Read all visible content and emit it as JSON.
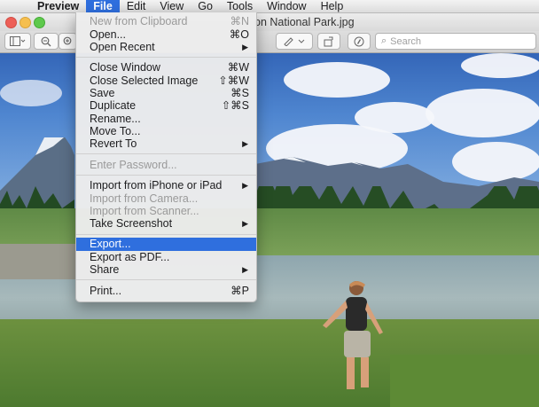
{
  "menubar": {
    "app": "Preview",
    "items": [
      "File",
      "Edit",
      "View",
      "Go",
      "Tools",
      "Window",
      "Help"
    ]
  },
  "window": {
    "title": "on National Park.jpg",
    "search_placeholder": "Search"
  },
  "file_menu": {
    "items": [
      {
        "label": "New from Clipboard",
        "shortcut": "⌘N",
        "disabled": true
      },
      {
        "label": "Open...",
        "shortcut": "⌘O"
      },
      {
        "label": "Open Recent",
        "submenu": true
      },
      {
        "label": "Close Window",
        "shortcut": "⌘W"
      },
      {
        "label": "Close Selected Image",
        "shortcut": "⇧⌘W"
      },
      {
        "label": "Save",
        "shortcut": "⌘S"
      },
      {
        "label": "Duplicate",
        "shortcut": "⇧⌘S"
      },
      {
        "label": "Rename..."
      },
      {
        "label": "Move To..."
      },
      {
        "label": "Revert To",
        "submenu": true
      },
      {
        "label": "Enter Password...",
        "disabled": true
      },
      {
        "label": "Import from iPhone or iPad",
        "submenu": true
      },
      {
        "label": "Import from Camera...",
        "disabled": true
      },
      {
        "label": "Import from Scanner...",
        "disabled": true
      },
      {
        "label": "Take Screenshot",
        "submenu": true
      },
      {
        "label": "Export...",
        "highlighted": true
      },
      {
        "label": "Export as PDF..."
      },
      {
        "label": "Share",
        "submenu": true
      },
      {
        "label": "Print...",
        "shortcut": "⌘P"
      }
    ]
  },
  "colors": {
    "highlight": "#2f6fde",
    "traffic_red": "#ed5f57",
    "traffic_yellow": "#f5bf4f",
    "traffic_green": "#5ec94c"
  },
  "icons": [
    "apple-icon",
    "sidebar-toggle-icon",
    "zoom-out-icon",
    "zoom-in-icon",
    "markup-pen-icon",
    "rotate-icon",
    "annotate-icon",
    "search-icon",
    "submenu-arrow-icon"
  ]
}
